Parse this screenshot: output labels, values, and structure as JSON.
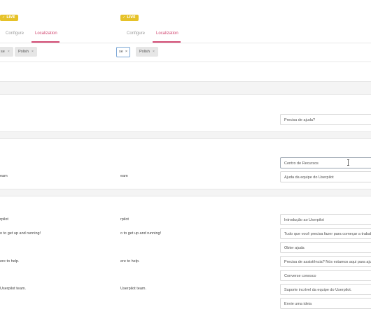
{
  "badges": [
    {
      "label": "LIVE"
    },
    {
      "label": "LIVE"
    }
  ],
  "tabs": [
    {
      "configure": "Configure",
      "localization": "Localization"
    },
    {
      "configure": "Configure",
      "localization": "Localization"
    }
  ],
  "languages_left": [
    {
      "label": "se",
      "remove": "×"
    },
    {
      "label": "Polish",
      "remove": "×"
    }
  ],
  "languages_right": [
    {
      "label": "se",
      "remove": "×"
    },
    {
      "label": "Polish",
      "remove": "×"
    }
  ],
  "rows": {
    "team_a": "eam",
    "team_b": "eam",
    "userpilot_a": "rpilot",
    "userpilot_b": "rpilot",
    "getup_a": "o to get up and running!",
    "getup_b": "o to get up and running!",
    "help_a": "ere to help.",
    "help_b": "ere to help.",
    "team_full_a": "Userpilot team.",
    "team_full_b": "Userpilot team."
  },
  "fields": {
    "need_help": "Precisa de ajuda?",
    "resource_center": "Centro de Recursos",
    "team_help": "Ajuda da equipe do Userpilot",
    "intro": "Introdução ao Userpilot",
    "all_you_need": "Tudo que você precisa fazer para começar a trabalhar",
    "other_help": "Obter ajuda",
    "need_assist": "Precisa de assistência? Nós estamos aqui para ajudar",
    "chat": "Converse conosco",
    "incredible": "Suporte incrível da equipe do Userpilot.",
    "send_idea": "Envie uma ideia"
  },
  "colors": {
    "accent": "#d24a73",
    "badge": "#e6c229"
  }
}
